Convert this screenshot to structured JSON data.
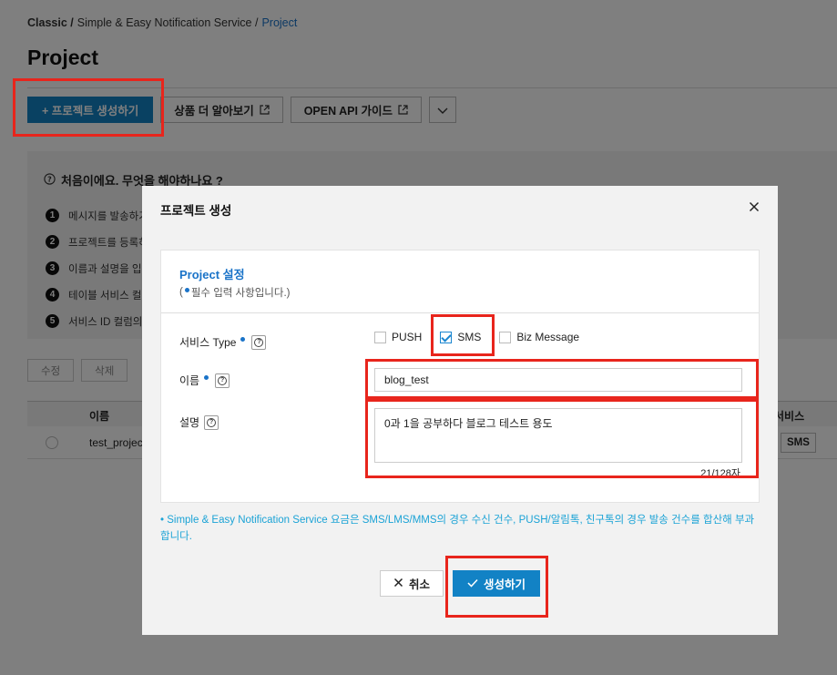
{
  "breadcrumb": {
    "root": "Classic /",
    "service": "Simple & Easy Notification Service /",
    "current": "Project"
  },
  "page": {
    "title": "Project",
    "toolbar": {
      "create_label": "+ 프로젝트 생성하기",
      "learn_more_label": "상품 더 알아보기",
      "api_guide_label": "OPEN API 가이드"
    },
    "info": {
      "title": "처음이에요. 무엇을 해야하나요 ?",
      "steps": [
        {
          "num": "1",
          "text": "메시지를 발송하기"
        },
        {
          "num": "2",
          "text": "프로젝트를 등록하"
        },
        {
          "num": "3",
          "text": "이름과 설명을 입"
        },
        {
          "num": "4",
          "text": "테이블 서비스 컬"
        },
        {
          "num": "5",
          "text": "서비스 ID 컬럼의"
        }
      ]
    },
    "row_actions": {
      "edit": "수정",
      "delete": "삭제"
    },
    "table": {
      "headers": {
        "name": "이름",
        "service": "서비스"
      },
      "rows": [
        {
          "name": "test_projec",
          "service": "SMS"
        }
      ]
    }
  },
  "modal": {
    "title": "프로젝트 생성",
    "panel_title": "Project 설정",
    "required_note_prefix": "(",
    "required_note_text": "필수 입력 사항입니다.)",
    "service_type_label": "서비스 Type",
    "service_options": [
      {
        "label": "PUSH",
        "checked": false
      },
      {
        "label": "SMS",
        "checked": true
      },
      {
        "label": "Biz Message",
        "checked": false
      }
    ],
    "name_label": "이름",
    "name_value": "blog_test",
    "desc_label": "설명",
    "desc_value": "0과 1을 공부하다 블로그 테스트 용도",
    "char_count": "21/128자",
    "note": "•  Simple & Easy Notification Service 요금은 SMS/LMS/MMS의 경우 수신 건수, PUSH/알림톡, 친구톡의 경우 발송 건수를 합산해 부과합니다.",
    "cancel_label": "취소",
    "create_label": "생성하기"
  },
  "colors": {
    "accent": "#1282c5",
    "link": "#1a73c8",
    "highlight": "#e8251c",
    "note": "#1ba3d6"
  }
}
